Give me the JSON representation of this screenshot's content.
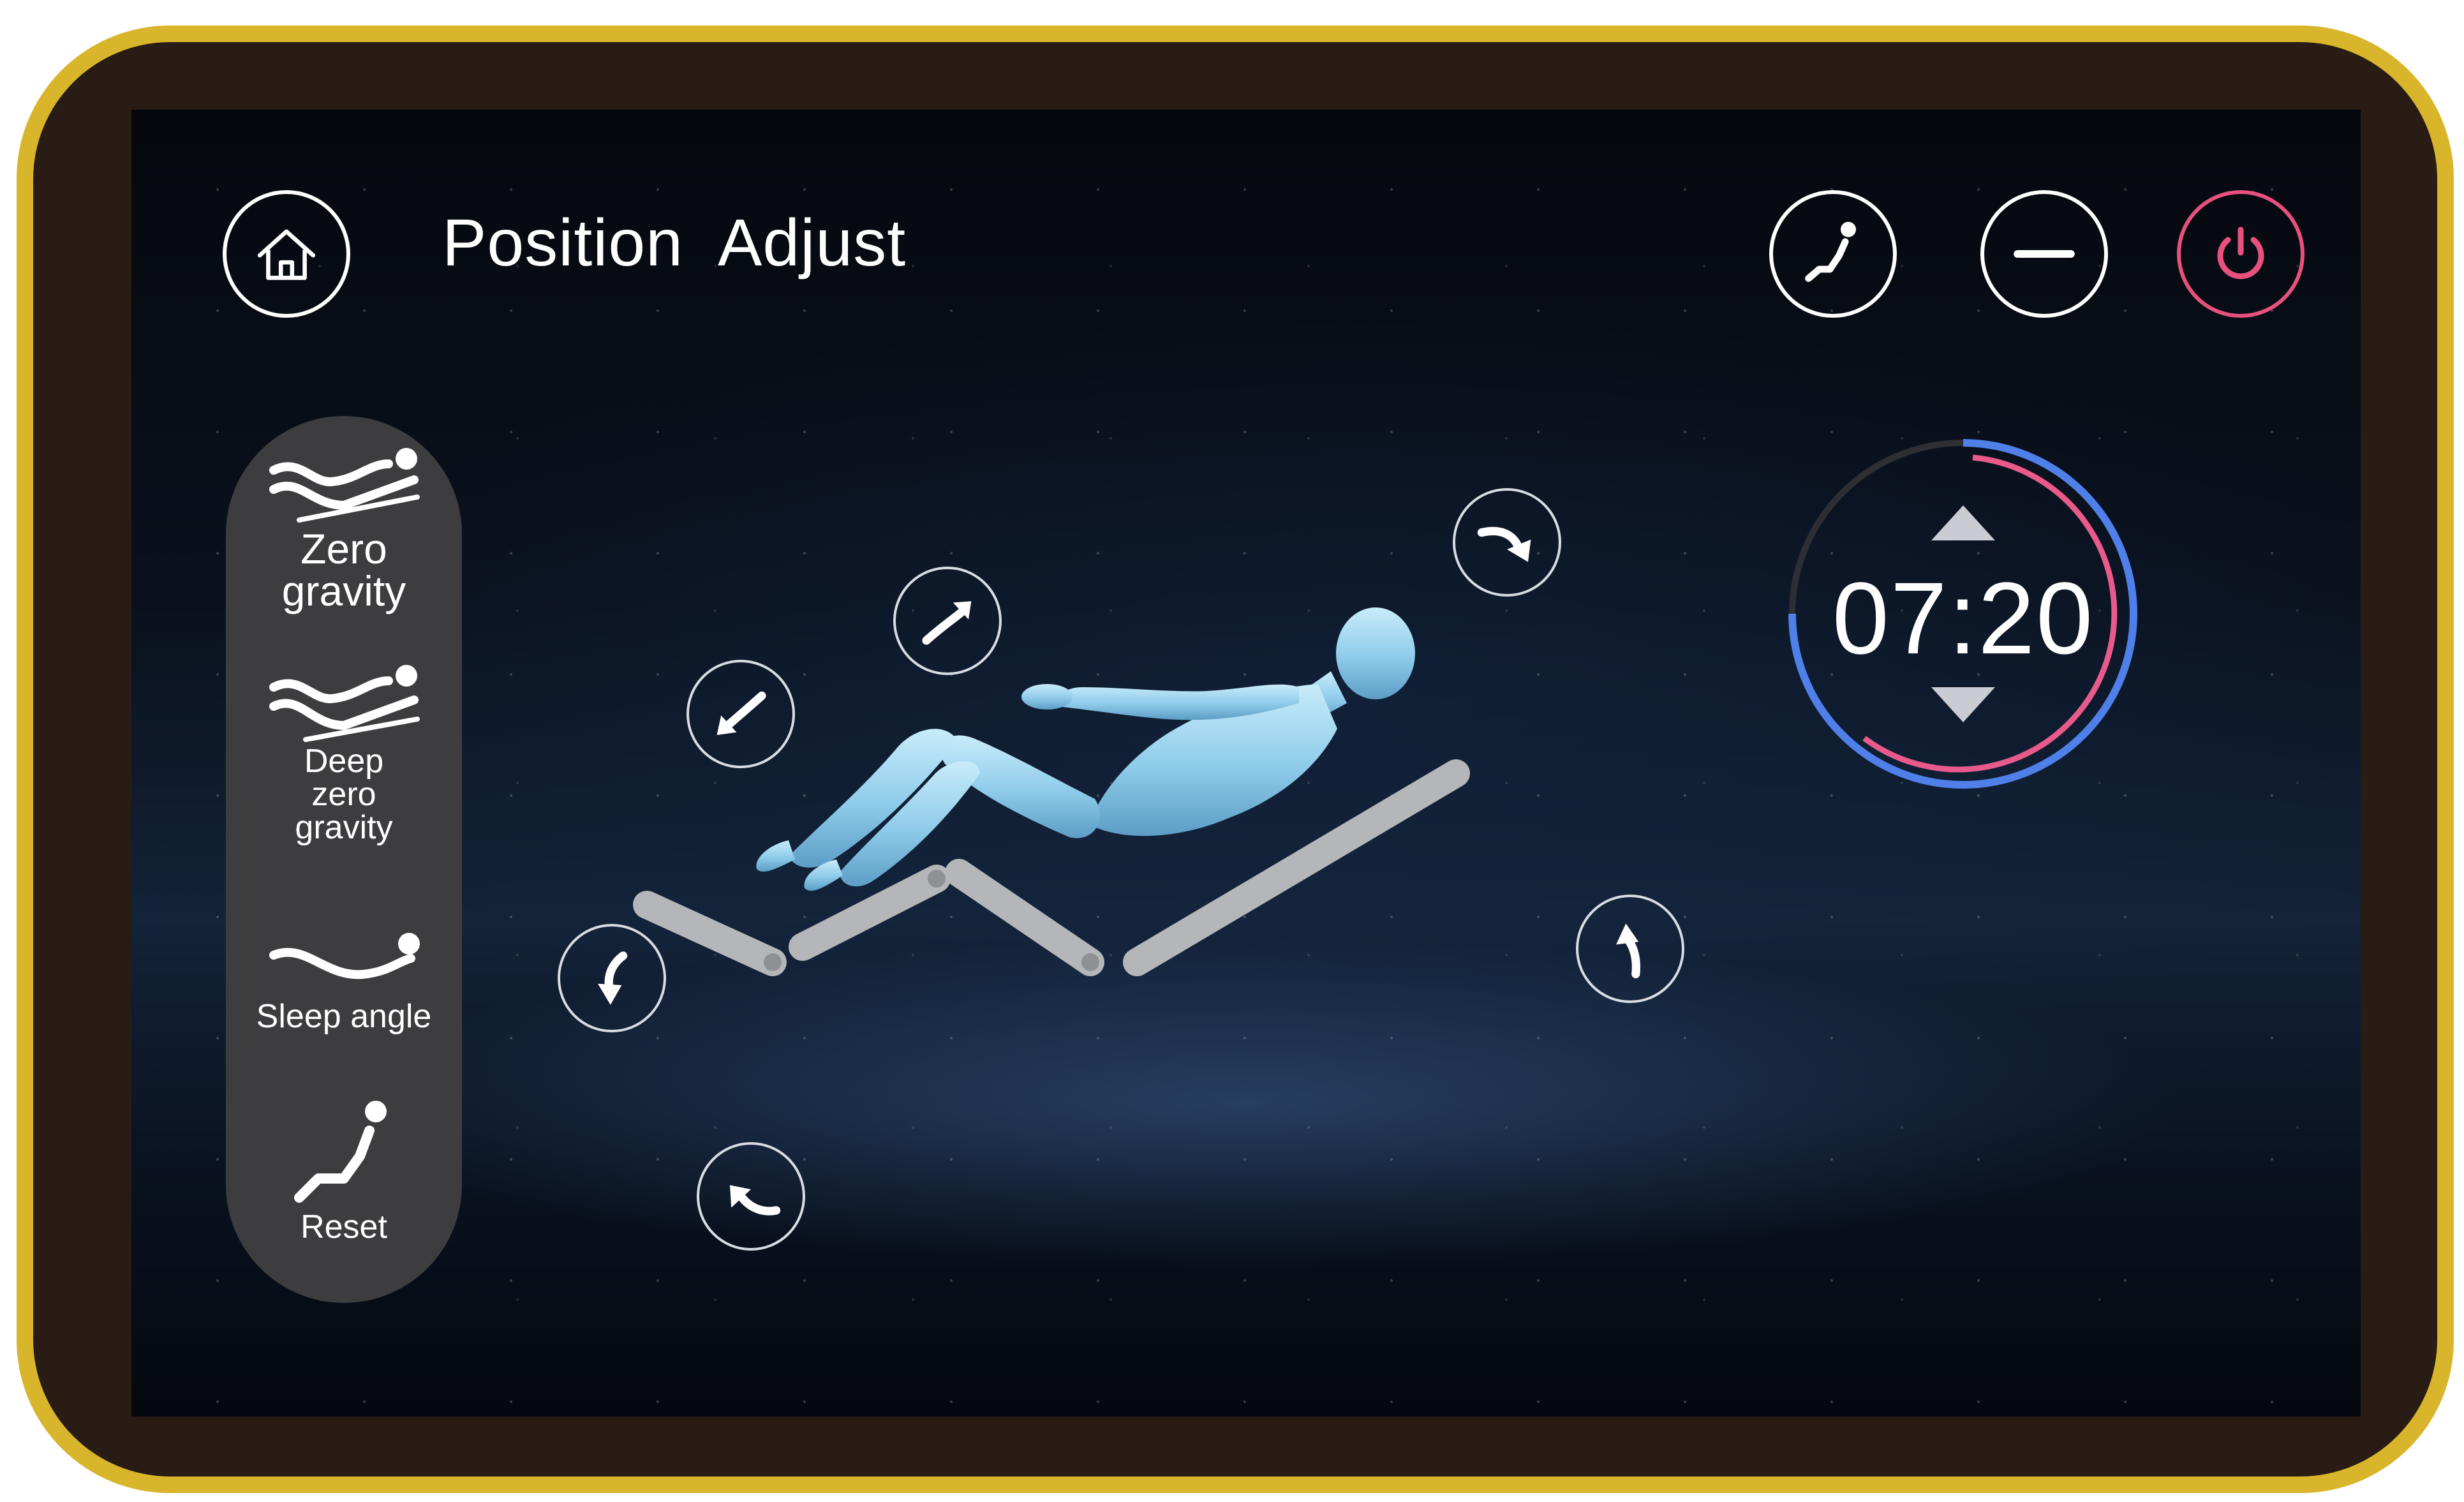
{
  "header": {
    "title": "Position  Adjust",
    "home_icon": "home-icon",
    "recline_icon": "recline-person-icon",
    "minus_icon": "minus-icon",
    "power_icon": "power-icon"
  },
  "presets": [
    {
      "line1": "Zero",
      "line2": "gravity",
      "line3": "",
      "icon": "zero-gravity-icon"
    },
    {
      "line1": "Deep",
      "line2": "zero",
      "line3": "gravity",
      "icon": "deep-zero-gravity-icon"
    },
    {
      "line1": "Sleep angle",
      "line2": "",
      "line3": "",
      "icon": "sleep-angle-icon"
    },
    {
      "line1": "Reset",
      "line2": "",
      "line3": "",
      "icon": "reset-icon"
    }
  ],
  "timer": {
    "value": "07:20",
    "up_icon": "triangle-up-icon",
    "down_icon": "triangle-down-icon"
  },
  "colors": {
    "bezel_gold": "#d8b52a",
    "bezel_dark": "#281c14",
    "power_accent": "#e8517f",
    "timer_pink": "#e95a8c",
    "timer_blue": "#4f7fe8",
    "figure_blue": "#9fd6ee",
    "panel_gray": "#3d3d3f"
  },
  "adjust_arrows": [
    "backrest-up-arrow-icon",
    "backrest-down-arrow-icon",
    "recline-forward-arrow-icon",
    "headrest-tilt-arrow-icon",
    "legrest-raise-arrow-icon",
    "legrest-lower-arrow-icon",
    "legrest-extend-arrow-icon"
  ]
}
